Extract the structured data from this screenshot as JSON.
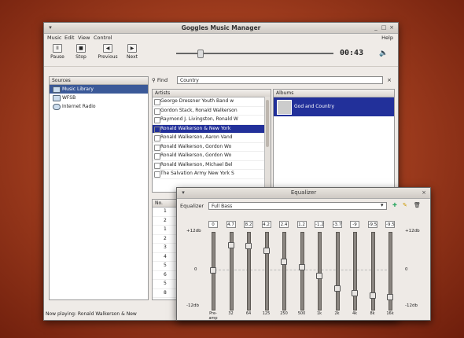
{
  "window": {
    "title": "Goggles Music Manager",
    "controls": [
      "_",
      "□",
      "×"
    ]
  },
  "menu": {
    "items": [
      "Music",
      "Edit",
      "View",
      "Control"
    ],
    "help": "Help"
  },
  "toolbar": {
    "pause": "Pause",
    "stop": "Stop",
    "previous": "Previous",
    "next": "Next",
    "time": "00:43",
    "seek_progress": 0.15,
    "icons": {
      "pause": "pause-icon",
      "stop": "stop-icon",
      "previous": "previous-icon",
      "next": "next-icon",
      "volume": "volume-icon"
    }
  },
  "sources": {
    "header": "Sources",
    "items": [
      {
        "label": "Music Library",
        "selected": true
      },
      {
        "label": "WFSB",
        "selected": false
      },
      {
        "label": "Internet Radio",
        "selected": false
      }
    ]
  },
  "find": {
    "label": "Find",
    "value": "Country"
  },
  "artists": {
    "header": "Artists",
    "items": [
      {
        "label": "George Dressner Youth Band w",
        "selected": false
      },
      {
        "label": "Gordon Stack, Ronald Walkerson",
        "selected": false
      },
      {
        "label": "Raymond J. Livingston, Ronald W",
        "selected": false
      },
      {
        "label": "Ronald Walkerson & New York",
        "selected": true
      },
      {
        "label": "Ronald Walkerson, Aaron Vand",
        "selected": false
      },
      {
        "label": "Ronald Walkerson, Gordon Wo",
        "selected": false
      },
      {
        "label": "Ronald Walkerson, Gordon Wo",
        "selected": false
      },
      {
        "label": "Ronald Walkerson, Michael Bel",
        "selected": false
      },
      {
        "label": "The Salvation Army New York S",
        "selected": false
      }
    ]
  },
  "albums": {
    "header": "Albums",
    "items": [
      {
        "label": "God and Country",
        "selected": true
      }
    ]
  },
  "tracks": {
    "header": "No.",
    "numbers": [
      "1",
      "2",
      "1",
      "2",
      "3",
      "4",
      "5",
      "6",
      "5",
      "8"
    ]
  },
  "status": {
    "text": "Now playing: Ronald Walkerson & New"
  },
  "equalizer": {
    "title": "Equalizer",
    "label": "Equalizer",
    "preset": "Full Bass",
    "db_top": "+12db",
    "db_mid": "0",
    "db_bottom": "-12db",
    "bands": [
      {
        "value": "0",
        "label": "Pre-amp",
        "level": 0.5
      },
      {
        "value": "4.7",
        "label": "32",
        "level": 0.86
      },
      {
        "value": "8.2",
        "label": "64",
        "level": 0.84
      },
      {
        "value": "4.2",
        "label": "125",
        "level": 0.78
      },
      {
        "value": "2.4",
        "label": "250",
        "level": 0.62
      },
      {
        "value": "1.2",
        "label": "500",
        "level": 0.55
      },
      {
        "value": "-1.2",
        "label": "1k",
        "level": 0.42
      },
      {
        "value": "-3.7",
        "label": "2k",
        "level": 0.24
      },
      {
        "value": "-9",
        "label": "4k",
        "level": 0.18
      },
      {
        "value": "-9.5",
        "label": "8k",
        "level": 0.14
      },
      {
        "value": "-9.5",
        "label": "16k",
        "level": 0.12
      }
    ]
  },
  "colors": {
    "selection": "#22309a",
    "desktop": "#a54020"
  }
}
